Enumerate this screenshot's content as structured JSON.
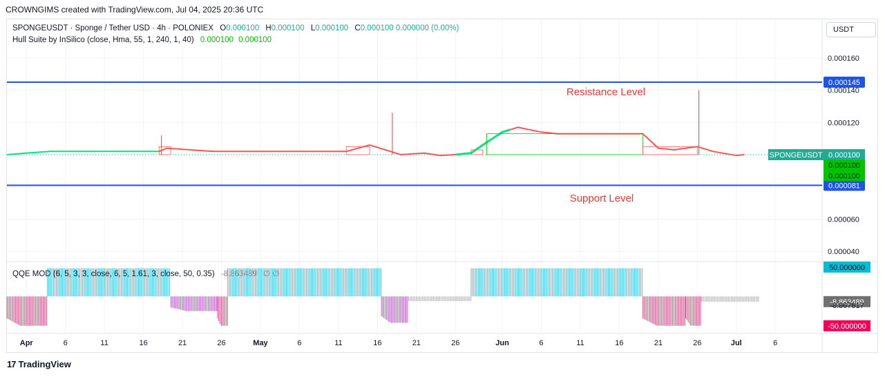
{
  "header": {
    "credit": "CROWNGIMS created with TradingView.com, Jul 04, 2025 20:36 UTC"
  },
  "legend": {
    "symbol": "SPONGEUSDT · Sponge / Tether USD · 4h · POLONIEX",
    "o_label": "O",
    "o_value": "0.000100",
    "h_label": "H",
    "h_value": "0.000100",
    "l_label": "L",
    "l_value": "0.000100",
    "c_label": "C",
    "c_value": "0.000100",
    "change": "0.000000 (0.00%)",
    "hull_label": "Hull Suite by InSilico (close, Hma, 55, 1, 240, 1, 40)",
    "hull_v1": "0.000100",
    "hull_v2": "0.000100",
    "qqe_label": "QQE MOD (6, 5, 3, 3, close, 6, 5, 1.61, 3, close, 50, 0.35)",
    "qqe_v1": "-8.863489"
  },
  "currency_button": "USDT",
  "footer": {
    "brand": "TradingView"
  },
  "chart_data": [
    {
      "type": "line",
      "name": "price-pane",
      "symbol_tag": "SPONGEUSDT",
      "y_ticks": [
        "0.000160",
        "0.000140",
        "0.000120",
        "0.000060",
        "0.000040"
      ],
      "y_tick_values": [
        0.00016,
        0.00014,
        0.00012,
        6e-05,
        4e-05
      ],
      "ylim": [
        3.4e-05,
        0.000184
      ],
      "x_ticks": [
        "Apr",
        "6",
        "11",
        "16",
        "21",
        "26",
        "May",
        "6",
        "11",
        "16",
        "21",
        "26",
        "Jun",
        "6",
        "11",
        "16",
        "21",
        "26",
        "Jul",
        "6"
      ],
      "x_tick_days": [
        0,
        5,
        10,
        15,
        20,
        25,
        30,
        35,
        40,
        45,
        50,
        55,
        61,
        66,
        71,
        76,
        81,
        86,
        91,
        96
      ],
      "xlim": [
        -2.5,
        102
      ],
      "levels": [
        {
          "label": "Resistance Level",
          "value": 0.000145,
          "tag": "0.000145",
          "color": "#1e53e5"
        },
        {
          "label": "Support Level",
          "value": 8.1e-05,
          "tag": "0.000081",
          "color": "#1e53e5"
        }
      ],
      "price_tags": [
        {
          "text": "0.000100",
          "value": 0.0001,
          "color": "#22ab94"
        },
        {
          "text": "0.000100",
          "value": 9.35e-05,
          "color": "#00c300"
        },
        {
          "text": "0.000100",
          "value": 8.7e-05,
          "color": "#00c300"
        }
      ],
      "current_price": 0.0001,
      "hull_points": [
        [
          -2.5,
          0.0001
        ],
        [
          0,
          0.000101
        ],
        [
          3,
          0.000102
        ],
        [
          8,
          0.000102
        ],
        [
          17,
          0.000102
        ],
        [
          18,
          0.000104
        ],
        [
          21,
          0.000103
        ],
        [
          24,
          0.000102
        ],
        [
          32,
          0.000102
        ],
        [
          41,
          0.000102
        ],
        [
          44,
          0.000106
        ],
        [
          46,
          0.000103
        ],
        [
          48,
          0.0001
        ],
        [
          51,
          0.000101
        ],
        [
          53,
          9.95e-05
        ],
        [
          55,
          0.0001
        ],
        [
          57,
          0.000101
        ],
        [
          58.5,
          0.000106
        ],
        [
          61,
          0.000114
        ],
        [
          63,
          0.000117
        ],
        [
          66,
          0.000114
        ],
        [
          68,
          0.000113
        ],
        [
          76,
          0.000113
        ],
        [
          79,
          0.000113
        ],
        [
          81,
          0.000104
        ],
        [
          83,
          0.000103
        ],
        [
          86,
          0.000105
        ],
        [
          88,
          0.000102
        ],
        [
          91,
          9.95e-05
        ],
        [
          92,
          0.0001
        ]
      ],
      "hull_colors": [
        [
          -2.5,
          17,
          "#00e676"
        ],
        [
          17,
          44,
          "#ff5252"
        ],
        [
          44,
          55,
          "#ff5252"
        ],
        [
          55,
          62,
          "#00e676"
        ],
        [
          62,
          86,
          "#ff5252"
        ],
        [
          86,
          92,
          "#ff5252"
        ]
      ],
      "spikes": [
        {
          "day": 17.3,
          "high": 0.000112,
          "color": "#ff5252"
        },
        {
          "day": 46.9,
          "high": 0.000126,
          "color": "#ff5252"
        },
        {
          "day": 86.2,
          "high": 0.00014,
          "color": "#ff5252"
        }
      ]
    },
    {
      "type": "bar",
      "name": "qqe-pane",
      "y_ticks": [
        "50.000000",
        "-8.863489",
        "-8.867817",
        "-50.000000"
      ],
      "ylim": [
        -62,
        58
      ],
      "segments": [
        {
          "from": -2.5,
          "to": 2.7,
          "value": -50,
          "color": "#c2185b"
        },
        {
          "from": 2.7,
          "to": 18.5,
          "value": 48,
          "color": "#00b7d8"
        },
        {
          "from": 18.5,
          "to": 24.5,
          "value": -25,
          "color": "#9c27b0"
        },
        {
          "from": 24.5,
          "to": 25.8,
          "value": -50,
          "color": "#c2185b"
        },
        {
          "from": 25.8,
          "to": 45.5,
          "value": 48,
          "color": "#00b7d8"
        },
        {
          "from": 45.5,
          "to": 49,
          "value": -45,
          "color": "#9c27b0"
        },
        {
          "from": 49,
          "to": 57,
          "value": -8,
          "color": "#9e9e9e"
        },
        {
          "from": 57,
          "to": 79,
          "value": 48,
          "color": "#00b7d8"
        },
        {
          "from": 79,
          "to": 84.5,
          "value": -50,
          "color": "#c2185b"
        },
        {
          "from": 84.5,
          "to": 86.5,
          "value": -50,
          "color": "#c2185b"
        },
        {
          "from": 86.5,
          "to": 94,
          "value": -9,
          "color": "#9e9e9e"
        }
      ],
      "tags": [
        {
          "text": "50.000000",
          "value": 50,
          "bg": "#00bcd4",
          "fg": "#131722"
        },
        {
          "text": "-8.863489",
          "value": -8.86,
          "bg": "#707070",
          "fg": "#ffffff"
        },
        {
          "text": "-8.867817",
          "value": -14.8,
          "bg": "none",
          "fg": "#131722"
        },
        {
          "text": "-50.000000",
          "value": -50,
          "bg": "#f50057",
          "fg": "#ffffff"
        }
      ]
    }
  ]
}
